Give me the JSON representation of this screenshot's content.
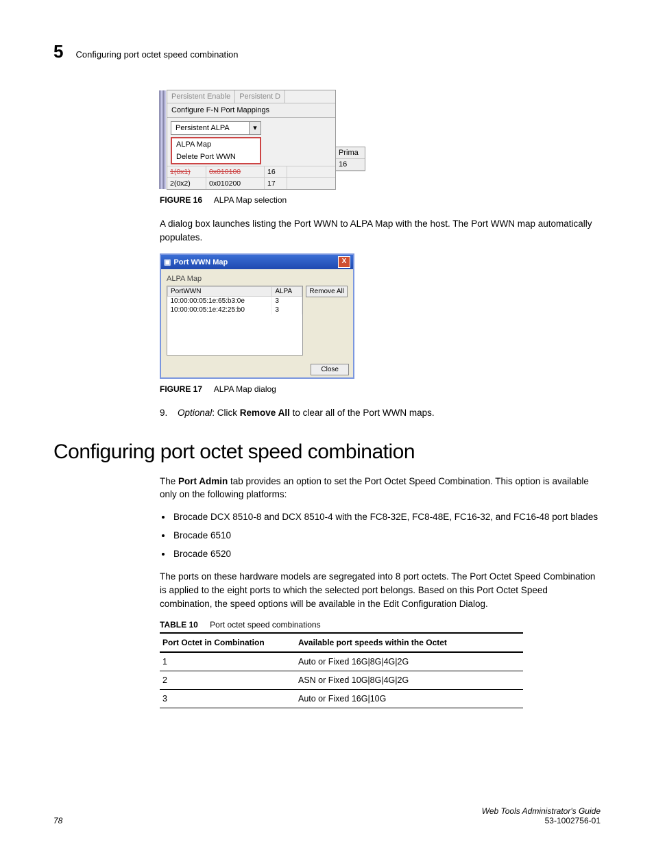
{
  "header": {
    "chapter_number": "5",
    "running_head": "Configuring port octet speed combination"
  },
  "figure16": {
    "buttons": {
      "persist_enable": "Persistent Enable",
      "persist_d": "Persistent D"
    },
    "configure_mappings": "Configure F-N Port Mappings",
    "dropdown_value": "Persistent ALPA",
    "menu": {
      "alpa_map": "ALPA Map",
      "delete_port": "Delete Port WWN"
    },
    "rows": [
      {
        "c1": "1(0x1)",
        "c2": "0x010100",
        "c3": "16",
        "struck": true
      },
      {
        "c1": "2(0x2)",
        "c2": "0x010200",
        "c3": "17",
        "struck": false
      }
    ],
    "prime": {
      "head": "Prima",
      "val": "16"
    },
    "caption_label": "FIGURE 16",
    "caption_text": "ALPA Map selection"
  },
  "para_after_fig16": "A dialog box launches listing the Port WWN to ALPA Map with the host. The Port WWN map automatically populates.",
  "figure17": {
    "title": "Port WWN Map",
    "group": "ALPA Map",
    "cols": {
      "portwwn": "PortWWN",
      "alpa": "ALPA"
    },
    "rows": [
      {
        "wwn": "10:00:00:05:1e:65:b3:0e",
        "alpa": "3"
      },
      {
        "wwn": "10:00:00:05:1e:42:25:b0",
        "alpa": "3"
      }
    ],
    "remove_all": "Remove All",
    "close": "Close",
    "caption_label": "FIGURE 17",
    "caption_text": "ALPA Map dialog"
  },
  "step9": {
    "num": "9.",
    "optional": "Optional",
    "pre": ": Click ",
    "bold": "Remove All",
    "post": " to clear all of the Port WWN maps."
  },
  "section_heading": "Configuring port octet speed combination",
  "para_port_admin_pre": "The ",
  "para_port_admin_bold": "Port Admin",
  "para_port_admin_post": " tab provides an option to set the Port Octet Speed Combination. This option is available only on the following platforms:",
  "platforms": [
    "Brocade DCX 8510-8 and DCX 8510-4 with the FC8-32E, FC8-48E, FC16-32, and FC16-48 port blades",
    "Brocade 6510",
    "Brocade 6520"
  ],
  "para_ports": "The ports on these hardware models are segregated into 8 port octets. The Port Octet Speed Combination is applied to the eight ports to which the selected port belongs. Based on this Port Octet Speed combination, the speed options will be available in the Edit Configuration Dialog.",
  "table10": {
    "label": "TABLE 10",
    "title": "Port octet speed combinations",
    "col1": "Port Octet in Combination",
    "col2": "Available port speeds within the Octet",
    "rows": [
      {
        "c1": "1",
        "c2": "Auto or Fixed 16G|8G|4G|2G"
      },
      {
        "c1": "2",
        "c2": "ASN or Fixed 10G|8G|4G|2G"
      },
      {
        "c1": "3",
        "c2": "Auto or Fixed 16G|10G"
      }
    ]
  },
  "footer": {
    "page": "78",
    "doc_title": "Web Tools Administrator's Guide",
    "doc_number": "53-1002756-01"
  }
}
